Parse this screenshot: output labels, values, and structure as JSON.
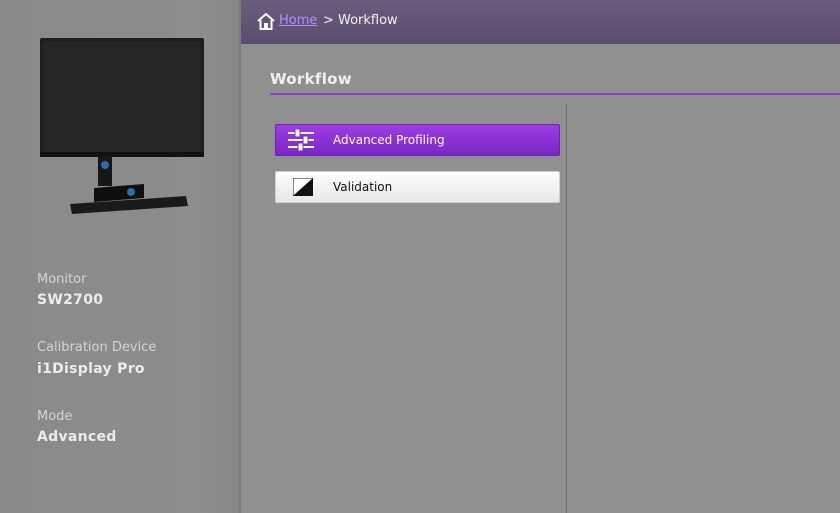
{
  "breadcrumb": {
    "home_label": "Home",
    "separator": ">",
    "current_label": "Workflow"
  },
  "section": {
    "title": "Workflow"
  },
  "menu": {
    "items": [
      {
        "label": "Advanced Profiling",
        "icon": "sliders-icon",
        "selected": true
      },
      {
        "label": "Validation",
        "icon": "validation-contrast-icon",
        "selected": false
      }
    ]
  },
  "sidebar": {
    "monitor_label": "Monitor",
    "monitor_value": "SW2700",
    "device_label": "Calibration Device",
    "device_value": "i1Display Pro",
    "mode_label": "Mode",
    "mode_value": "Advanced",
    "image": "monitor-product-image"
  },
  "colors": {
    "accent": "#8540c8",
    "selected_button": "#8a30d5",
    "topbar": "#62546f",
    "background": "#909090"
  }
}
